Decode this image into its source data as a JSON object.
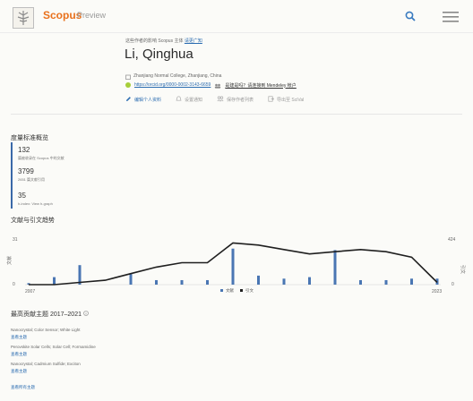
{
  "header": {
    "brand": "Scopus",
    "brand_sub": "Preview",
    "icons": {
      "search": "search-icon",
      "menu": "hamburger-menu-icon",
      "logo": "elsevier-tree-logo"
    }
  },
  "profile": {
    "note": "这些作者的影响 Scopus 主体",
    "note_link": "请更广知",
    "name": "Li, Qinghua",
    "affiliation": "Zhanjiang Normal College, Zhanjiang, China",
    "orcid": "https://orcid.org/0000-0002-3143-6659",
    "author_link": "是建是吗？请连接到 Mendeley 帐户"
  },
  "actions": [
    {
      "label": "编辑个人资料",
      "icon": "pencil-icon",
      "primary": true
    },
    {
      "label": "设置通知",
      "icon": "bell-icon",
      "primary": false
    },
    {
      "label": "保存作者列表",
      "icon": "people-icon",
      "primary": false
    },
    {
      "label": "导出至 SciVal",
      "icon": "export-icon",
      "primary": false
    }
  ],
  "metrics": {
    "title": "度量标准概览",
    "items": [
      {
        "value": "132",
        "label": "篇被收录在 Scopus 中的文献"
      },
      {
        "value": "3799",
        "label": "2651 篇文献引用"
      },
      {
        "value": "35",
        "label": "h-index: View h-graph"
      }
    ]
  },
  "trend": {
    "title": "文献与引文趋势",
    "ylabel_left": "文献",
    "ylabel_right": "引文",
    "legend_docs": "文献",
    "legend_cites": "引文"
  },
  "chart_data": {
    "type": "bar",
    "x": [
      2007,
      2008,
      2009,
      2010,
      2011,
      2012,
      2013,
      2014,
      2015,
      2016,
      2017,
      2018,
      2019,
      2020,
      2021,
      2022,
      2023
    ],
    "series": [
      {
        "name": "文献",
        "values": [
          1,
          5,
          13,
          0,
          7,
          3,
          3,
          3,
          24,
          6,
          4,
          5,
          23,
          3,
          3,
          4,
          4
        ]
      },
      {
        "name": "引文",
        "values": [
          0,
          0,
          20,
          40,
          100,
          160,
          200,
          200,
          380,
          360,
          320,
          280,
          300,
          320,
          300,
          250,
          20
        ]
      }
    ],
    "xlim": [
      2007,
      2023
    ],
    "ylim_left": [
      0,
      31
    ],
    "ylim_right": [
      0,
      424
    ],
    "left_ticks": [
      "31",
      "0"
    ],
    "right_ticks": [
      "424",
      "0"
    ],
    "x_ticks": [
      "2007",
      "2023"
    ],
    "colors": {
      "bars": "#4a76b3",
      "line": "#1f1f1f"
    }
  },
  "topics": {
    "title": "最高贡献主题 2017–2021",
    "items": [
      {
        "name": "Nanocrystal; Color Sensor; White Light",
        "link": "查看主题"
      },
      {
        "name": "Perovskite Solar Cells; Solar Cell; Formamidine",
        "link": "查看主题"
      },
      {
        "name": "Nanocrystal; Cadmium Sulfide; Exciton",
        "link": "查看主题"
      }
    ],
    "more": "查看所有主题"
  }
}
